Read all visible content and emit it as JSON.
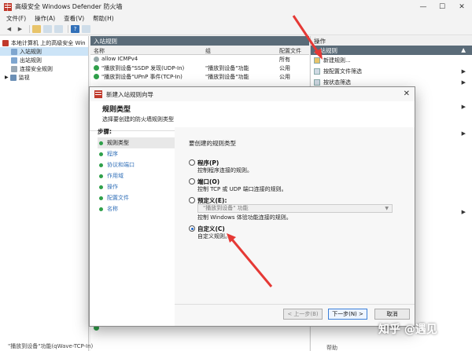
{
  "window": {
    "title": "高级安全 Windows Defender 防火墙",
    "controls": {
      "minimize": "—",
      "maximize": "☐",
      "close": "✕"
    }
  },
  "menu": [
    "文件(F)",
    "操作(A)",
    "查看(V)",
    "帮助(H)"
  ],
  "tree": {
    "root": "本地计算机 上的高级安全 Win",
    "items": [
      "入站规则",
      "出站规则",
      "连接安全规则",
      "监视"
    ]
  },
  "middle": {
    "header": "入站规则",
    "columns": {
      "name": "名称",
      "group": "组",
      "profile": "配置文件"
    },
    "rows": [
      {
        "name": "allow ICMPv4",
        "group": "",
        "profile": "所有"
      },
      {
        "name": "\"播放到设备\"SSDP 发现(UDP-In)",
        "group": "\"播放到设备\"功能",
        "profile": "公用"
      },
      {
        "name": "\"播放到设备\"UPnP 事件(TCP-In)",
        "group": "\"播放到设备\"功能",
        "profile": "公用"
      }
    ],
    "bottom_text": "\"播放到设备\"功能(qWave-TCP-In)"
  },
  "actions": {
    "header": "操作",
    "section": "入站规则",
    "items": [
      {
        "label": "新建规则...",
        "icon": "new-rule-icon",
        "arrow": ""
      },
      {
        "label": "按配置文件筛选",
        "icon": "filter-icon",
        "arrow": "▶"
      },
      {
        "label": "按状态筛选",
        "icon": "filter-icon",
        "arrow": "▶"
      }
    ],
    "bottom_text": "帮助"
  },
  "dialog": {
    "title": "新建入站规则向导",
    "close": "✕",
    "heading": "规则类型",
    "subheading": "选择要创建的防火墙规则类型",
    "steps_title": "步骤:",
    "steps": [
      "规则类型",
      "程序",
      "协议和端口",
      "作用域",
      "操作",
      "配置文件",
      "名称"
    ],
    "question": "要创建的规则类型",
    "options": [
      {
        "label": "程序(P)",
        "desc": "控制程序连接的规则。",
        "selected": false
      },
      {
        "label": "端口(O)",
        "desc": "控制 TCP 或 UDP 端口连接的规则。",
        "selected": false
      },
      {
        "label": "预定义(E):",
        "combo": "\"播放到设备\" 功能",
        "desc": "控制 Windows 体验功能连接的规则。",
        "selected": false
      },
      {
        "label": "自定义(C)",
        "desc": "自定义规则。",
        "selected": true
      }
    ],
    "buttons": {
      "back": "< 上一步(B)",
      "next": "下一步(N) >",
      "cancel": "取消"
    }
  },
  "watermark": "知乎 @遇见",
  "colors": {
    "accent": "#1a64c8",
    "header_bar": "#5a6b78",
    "annotation": "#e53935",
    "enabled_rule": "#2fa04a"
  }
}
